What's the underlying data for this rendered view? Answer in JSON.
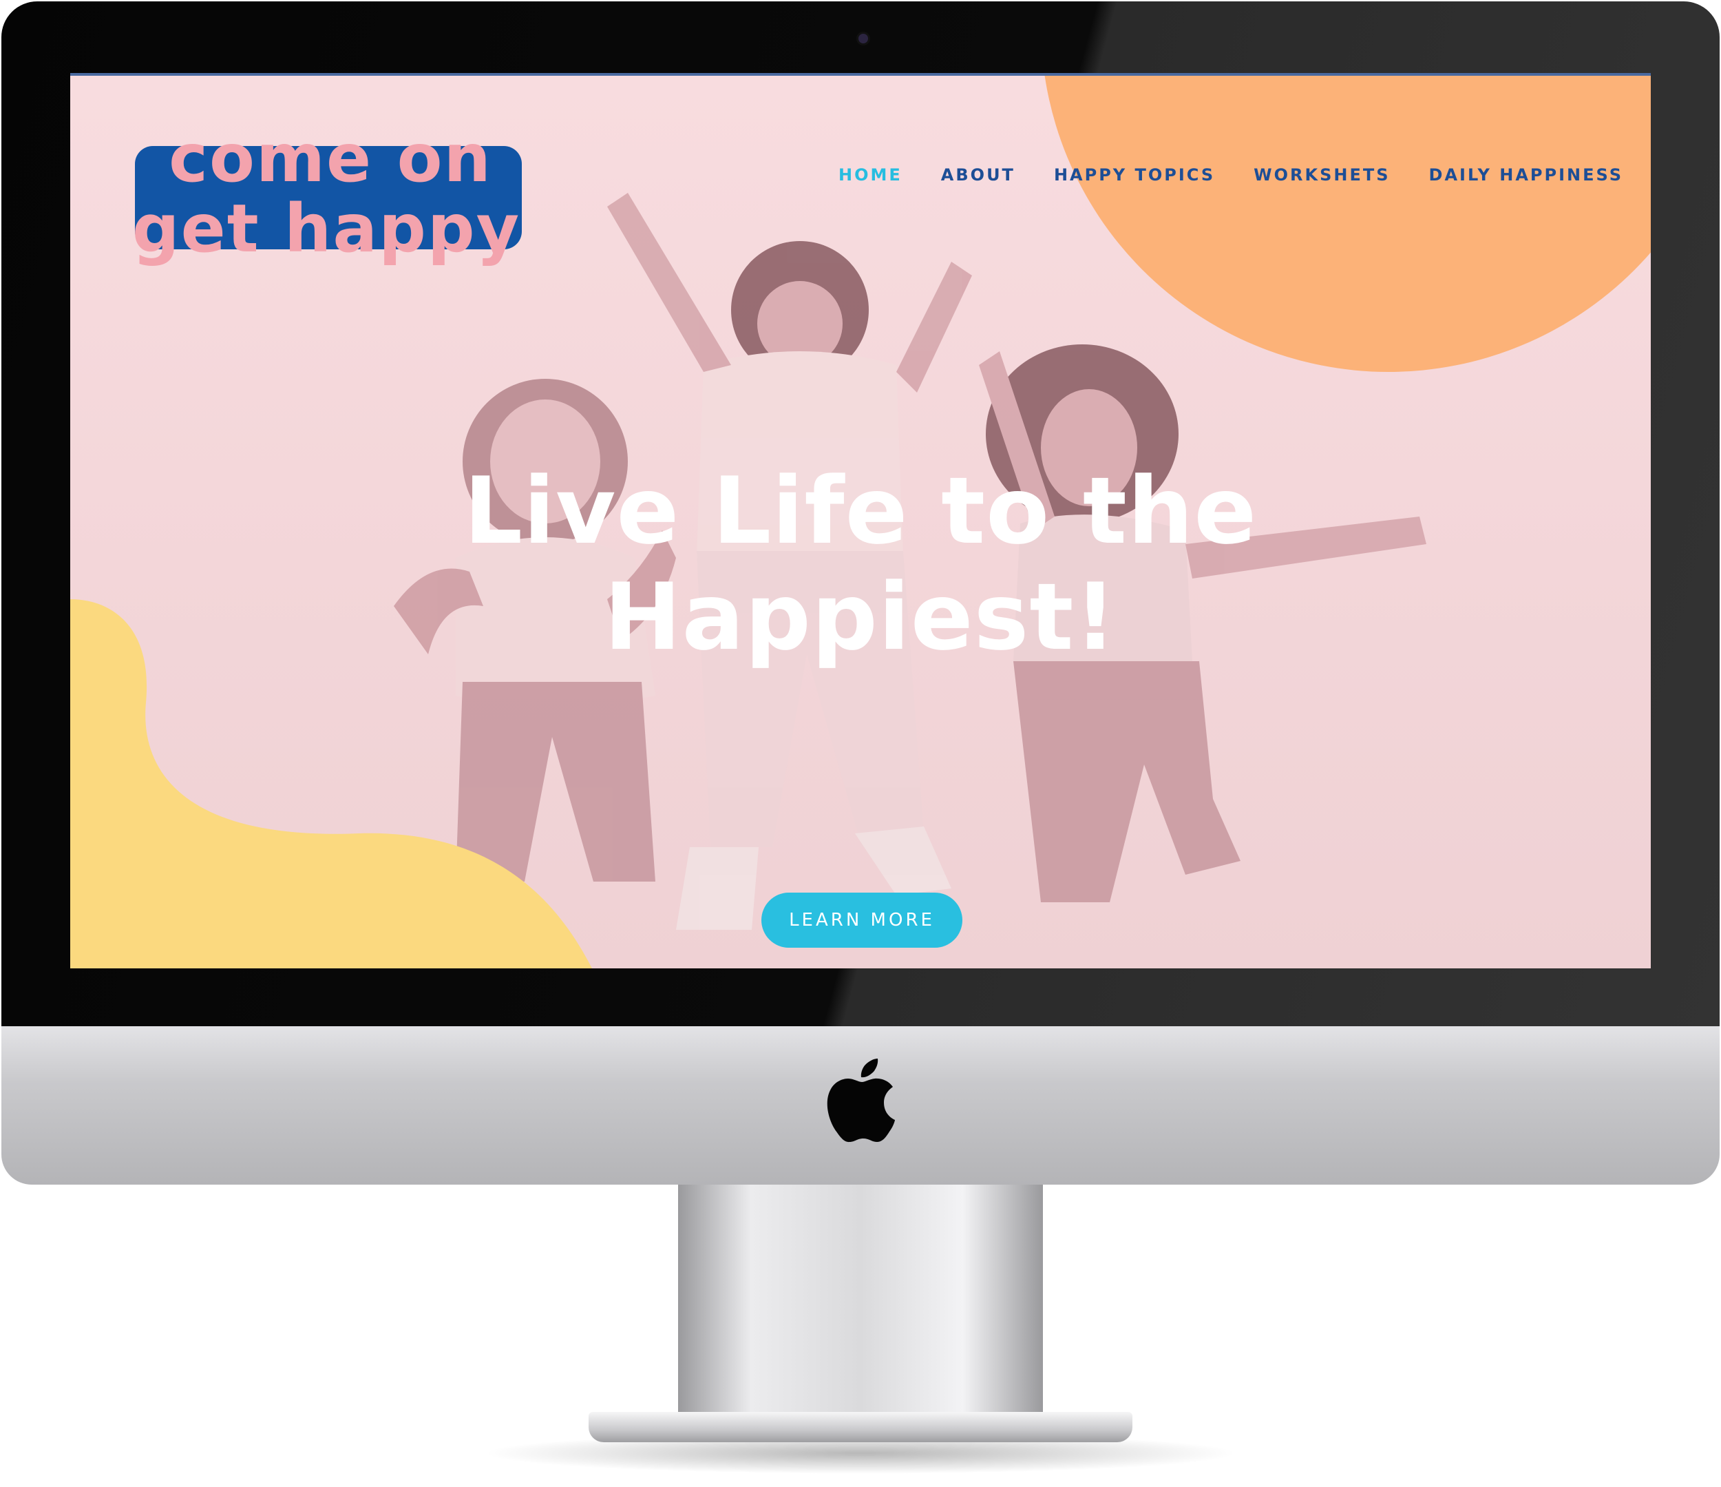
{
  "site": {
    "logo": {
      "line1": "come on",
      "line2": "get happy"
    },
    "nav": {
      "items": [
        {
          "label": "HOME",
          "active": true
        },
        {
          "label": "ABOUT",
          "active": false
        },
        {
          "label": "HAPPY TOPICS",
          "active": false
        },
        {
          "label": "WORKSHETS",
          "active": false
        },
        {
          "label": "DAILY HAPPINESS",
          "active": false
        }
      ]
    },
    "hero": {
      "title_line1": "Live Life to the",
      "title_line2": "Happiest!",
      "cta_label": "LEARN MORE"
    }
  },
  "colors": {
    "screen_bg": "#f6d9dc",
    "logo_box": "#1255a5",
    "logo_text": "#f3a3ad",
    "nav_text": "#1d4e96",
    "nav_active": "#27bde0",
    "orange_accent": "#fcb278",
    "yellow_accent": "#fbd97f",
    "cta_button": "#29bfe0"
  },
  "icons": {
    "device_logo": "apple-logo-icon",
    "camera": "camera-icon"
  }
}
